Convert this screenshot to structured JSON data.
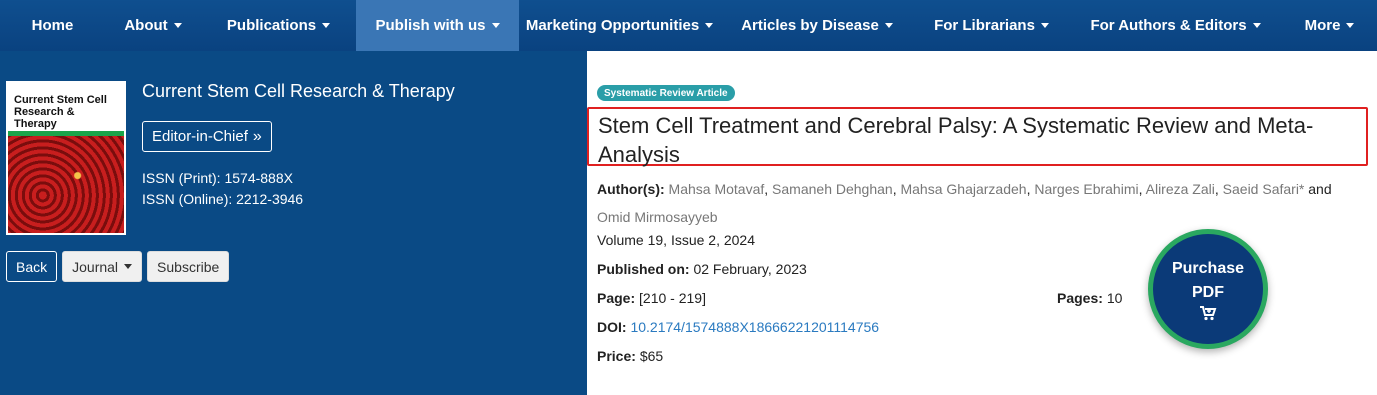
{
  "nav": {
    "items": [
      {
        "label": "Home",
        "dropdown": false
      },
      {
        "label": "About",
        "dropdown": true
      },
      {
        "label": "Publications",
        "dropdown": true
      },
      {
        "label": "Publish with us",
        "dropdown": true
      },
      {
        "label": "Marketing Opportunities",
        "dropdown": true
      },
      {
        "label": "Articles by Disease",
        "dropdown": true
      },
      {
        "label": "For Librarians",
        "dropdown": true
      },
      {
        "label": "For Authors & Editors",
        "dropdown": true
      },
      {
        "label": "More",
        "dropdown": true
      }
    ]
  },
  "journal": {
    "cover_title": "Current Stem Cell Research & Therapy",
    "name": "Current Stem Cell Research & Therapy",
    "editor_label": "Editor-in-Chief",
    "issn_print": "ISSN (Print): 1574-888X",
    "issn_online": "ISSN (Online): 2212-3946",
    "back_label": "Back",
    "journal_label": "Journal",
    "subscribe_label": "Subscribe"
  },
  "article": {
    "badge": "Systematic Review Article",
    "title": "Stem Cell Treatment and Cerebral Palsy: A Systematic Review and Meta-Analysis",
    "authors_label": "Author(s):",
    "authors": [
      "Mahsa Motavaf",
      "Samaneh Dehghan",
      "Mahsa Ghajarzadeh",
      "Narges Ebrahimi",
      "Alireza Zali",
      "Saeid Safari*",
      "Omid Mirmosayyeb"
    ],
    "volume": "Volume 19, Issue 2, 2024",
    "published_label": "Published on:",
    "published_value": "02 February, 2023",
    "page_label": "Page:",
    "page_value": "[210 - 219]",
    "pages_label": "Pages:",
    "pages_value": "10",
    "doi_label": "DOI:",
    "doi_value": "10.2174/1574888X18666221201114756",
    "price_label": "Price:",
    "price_value": "$65"
  },
  "purchase": {
    "line1": "Purchase",
    "line2": "PDF",
    "icon": "cart-icon"
  },
  "colors": {
    "nav_bg": "#0a4280",
    "active_tab": "#3a76b5",
    "panel_bg": "#0a4a85",
    "highlight": "#e02020",
    "badge": "#2a9ea8",
    "purchase_ring": "#2aa860"
  }
}
